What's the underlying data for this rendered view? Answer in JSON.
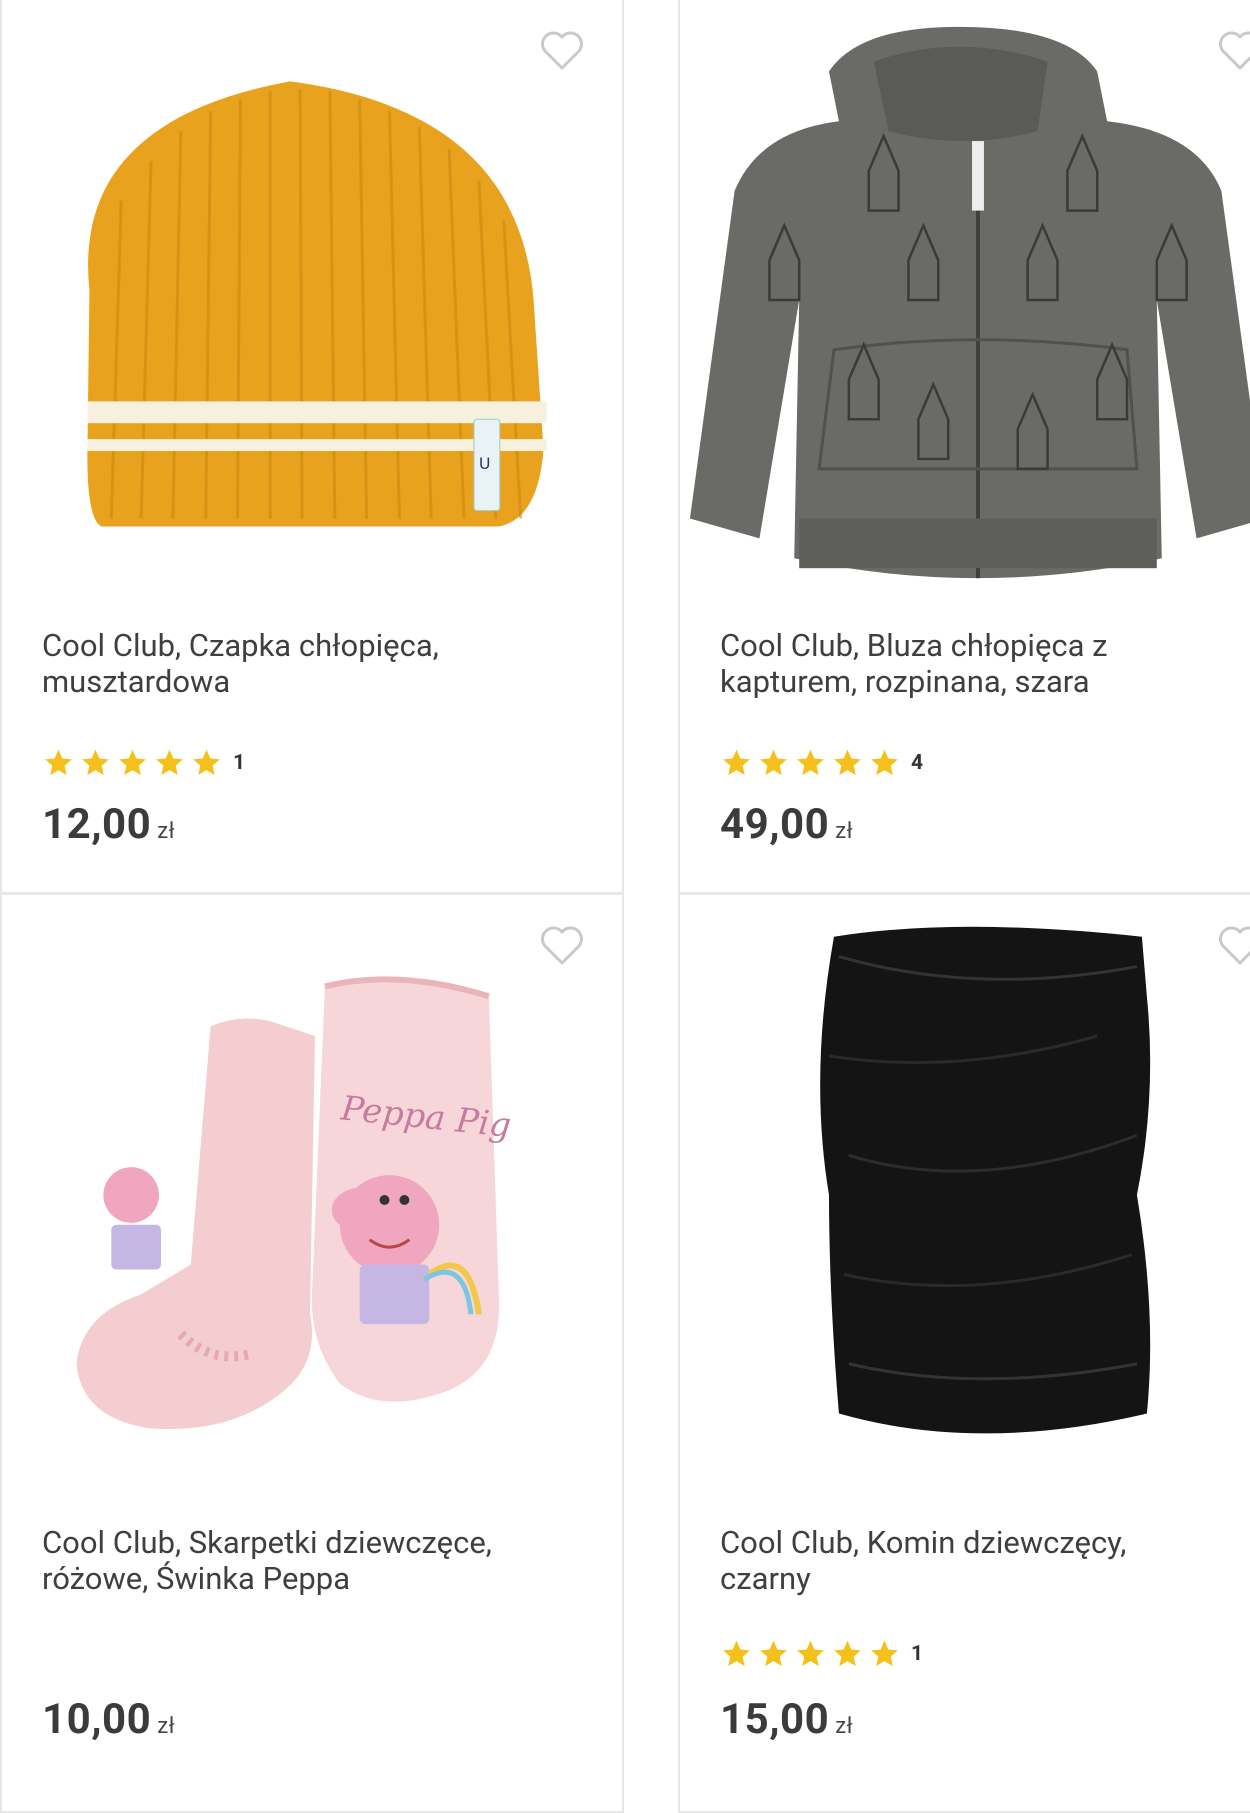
{
  "products": [
    {
      "title_line1": "Cool Club, Czapka chłopięca,",
      "title_line2": "musztardowa",
      "rating_count": "1",
      "price": "12,00",
      "currency": "zł",
      "image": "mustard-beanie"
    },
    {
      "title_line1": "Cool Club, Bluza chłopięca z",
      "title_line2": "kapturem, rozpinana, szara",
      "rating_count": "4",
      "price": "49,00",
      "currency": "zł",
      "image": "grey-hoodie"
    },
    {
      "title_line1": "Cool Club, Skarpetki dziewczęce,",
      "title_line2": "różowe, Świnka Peppa",
      "price": "10,00",
      "currency": "zł",
      "image": "pink-socks",
      "sock_print": "Peppa Pig"
    },
    {
      "title_line1": "Cool Club, Komin dziewczęcy,",
      "title_line2": "czarny",
      "rating_count": "1",
      "price": "15,00",
      "currency": "zł",
      "image": "black-snood"
    }
  ],
  "colors": {
    "star": "#f5c01a",
    "border": "#e7e7e7",
    "text": "#3f3f3f"
  },
  "icons": {
    "favorite": "heart-outline-icon",
    "rating": "star-icon"
  }
}
